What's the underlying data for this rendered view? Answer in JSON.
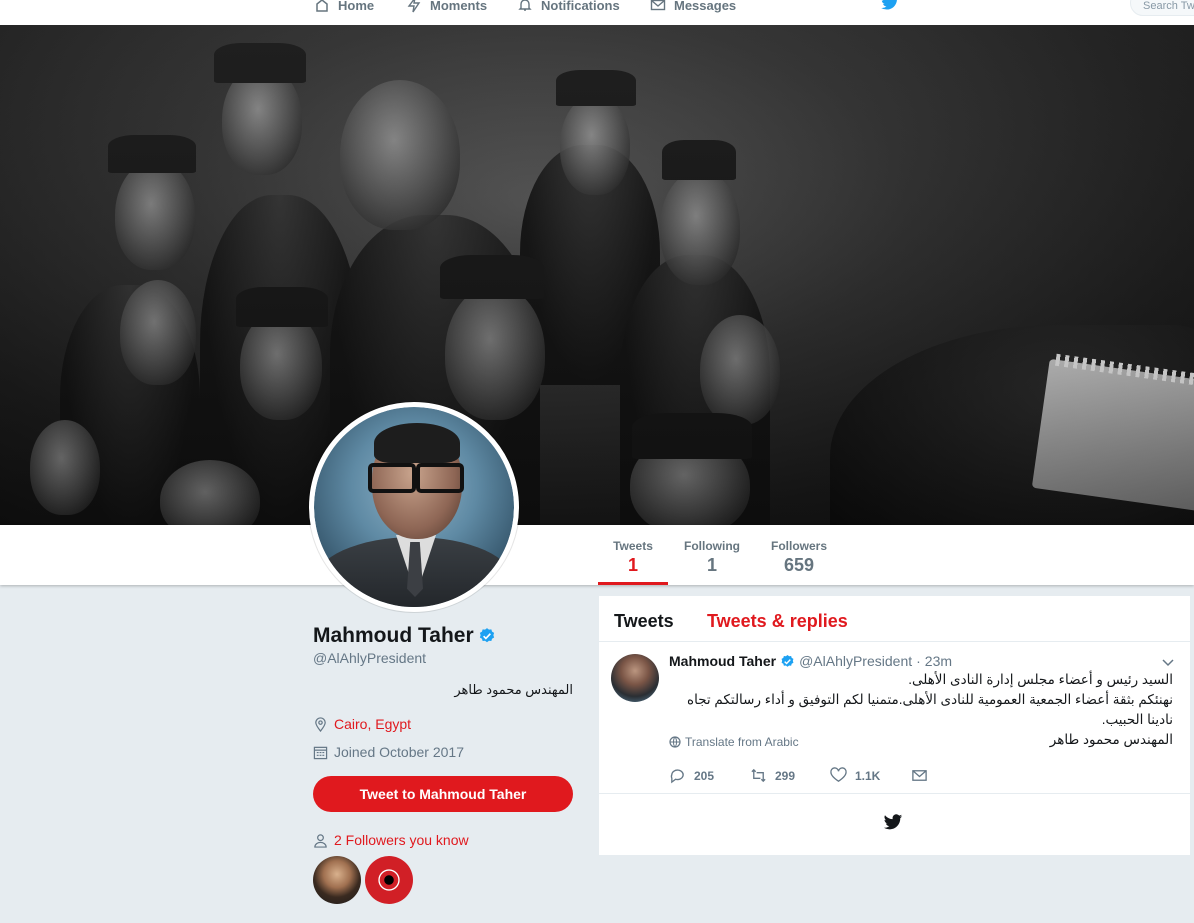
{
  "topnav": {
    "home": "Home",
    "moments": "Moments",
    "notifications": "Notifications",
    "messages": "Messages",
    "search_placeholder": "Search Tw"
  },
  "stats": {
    "tweets_label": "Tweets",
    "tweets_value": "1",
    "following_label": "Following",
    "following_value": "1",
    "followers_label": "Followers",
    "followers_value": "659"
  },
  "profile": {
    "name": "Mahmoud Taher",
    "handle": "@AlAhlyPresident",
    "bio": "المهندس محمود طاهر",
    "location": "Cairo, Egypt",
    "joined": "Joined October 2017",
    "tweet_to_label": "Tweet to Mahmoud Taher",
    "followers_you_know": "2 Followers you know"
  },
  "timeline": {
    "tab_tweets": "Tweets",
    "tab_replies": "Tweets & replies"
  },
  "tweet": {
    "name": "Mahmoud Taher",
    "handle": "@AlAhlyPresident",
    "dot": "·",
    "time": "23m",
    "line1": "السيد رئيس و أعضاء مجلس إدارة النادى الأهلى.",
    "line2": "نهنئكم بثقة أعضاء الجمعية العمومية للنادى الأهلى.متمنيا لكم التوفيق و أداء رسالتكم تجاه نادينا الحبيب.",
    "line3": "المهندس محمود طاهر",
    "translate": "Translate from Arabic",
    "replies": "205",
    "retweets": "299",
    "likes": "1.1K"
  },
  "colors": {
    "accent": "#e0191e",
    "verified": "#1da1f2",
    "background": "#e6ecf0"
  }
}
